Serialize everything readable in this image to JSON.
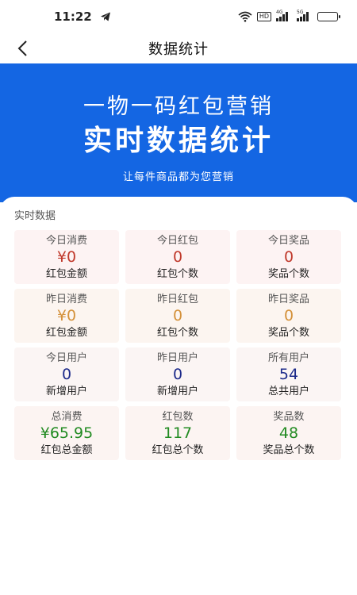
{
  "status_bar": {
    "time": "11:22",
    "hd_label": "HD",
    "signal1_label": "4G",
    "signal2_label": "5G"
  },
  "nav": {
    "title": "数据统计"
  },
  "hero": {
    "line1": "一物一码红包营销",
    "line2": "实时数据统计",
    "subtitle": "让每件商品都为您营销"
  },
  "section": {
    "title": "实时数据"
  },
  "stats": [
    [
      {
        "label": "今日消费",
        "value": "¥0",
        "caption": "红包金额"
      },
      {
        "label": "今日红包",
        "value": "0",
        "caption": "红包个数"
      },
      {
        "label": "今日奖品",
        "value": "0",
        "caption": "奖品个数"
      }
    ],
    [
      {
        "label": "昨日消费",
        "value": "¥0",
        "caption": "红包金额"
      },
      {
        "label": "昨日红包",
        "value": "0",
        "caption": "红包个数"
      },
      {
        "label": "昨日奖品",
        "value": "0",
        "caption": "奖品个数"
      }
    ],
    [
      {
        "label": "今日用户",
        "value": "0",
        "caption": "新增用户"
      },
      {
        "label": "昨日用户",
        "value": "0",
        "caption": "新增用户"
      },
      {
        "label": "所有用户",
        "value": "54",
        "caption": "总共用户"
      }
    ],
    [
      {
        "label": "总消费",
        "value": "¥65.95",
        "caption": "红包总金额"
      },
      {
        "label": "红包数",
        "value": "117",
        "caption": "红包总个数"
      },
      {
        "label": "奖品数",
        "value": "48",
        "caption": "奖品总个数"
      }
    ]
  ],
  "colors": {
    "hero_blue": "#1466e3",
    "row1_value": "#c0392b",
    "row2_value": "#d4913a",
    "row3_value": "#1c2a8a",
    "row4_value": "#228b22"
  },
  "icons": {
    "back": "chevron-left-icon",
    "telegram": "telegram-icon",
    "wifi": "wifi-icon",
    "battery": "battery-icon"
  }
}
